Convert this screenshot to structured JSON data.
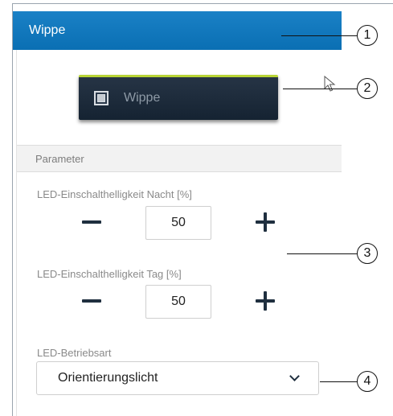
{
  "header": {
    "title": "Wippe"
  },
  "preview": {
    "label": "Wippe",
    "icon": "rocker-switch-icon"
  },
  "parameters": {
    "section_title": "Parameter",
    "night": {
      "label": "LED-Einschalthelligkeit Nacht [%]",
      "value": "50"
    },
    "day": {
      "label": "LED-Einschalthelligkeit Tag [%]",
      "value": "50"
    },
    "mode": {
      "label": "LED-Betriebsart",
      "value": "Orientierungslicht"
    }
  },
  "callouts": [
    "1",
    "2",
    "3",
    "4"
  ],
  "colors": {
    "header": "#0a75bc",
    "accent": "#b8d435",
    "button": "#1d2b3b"
  }
}
